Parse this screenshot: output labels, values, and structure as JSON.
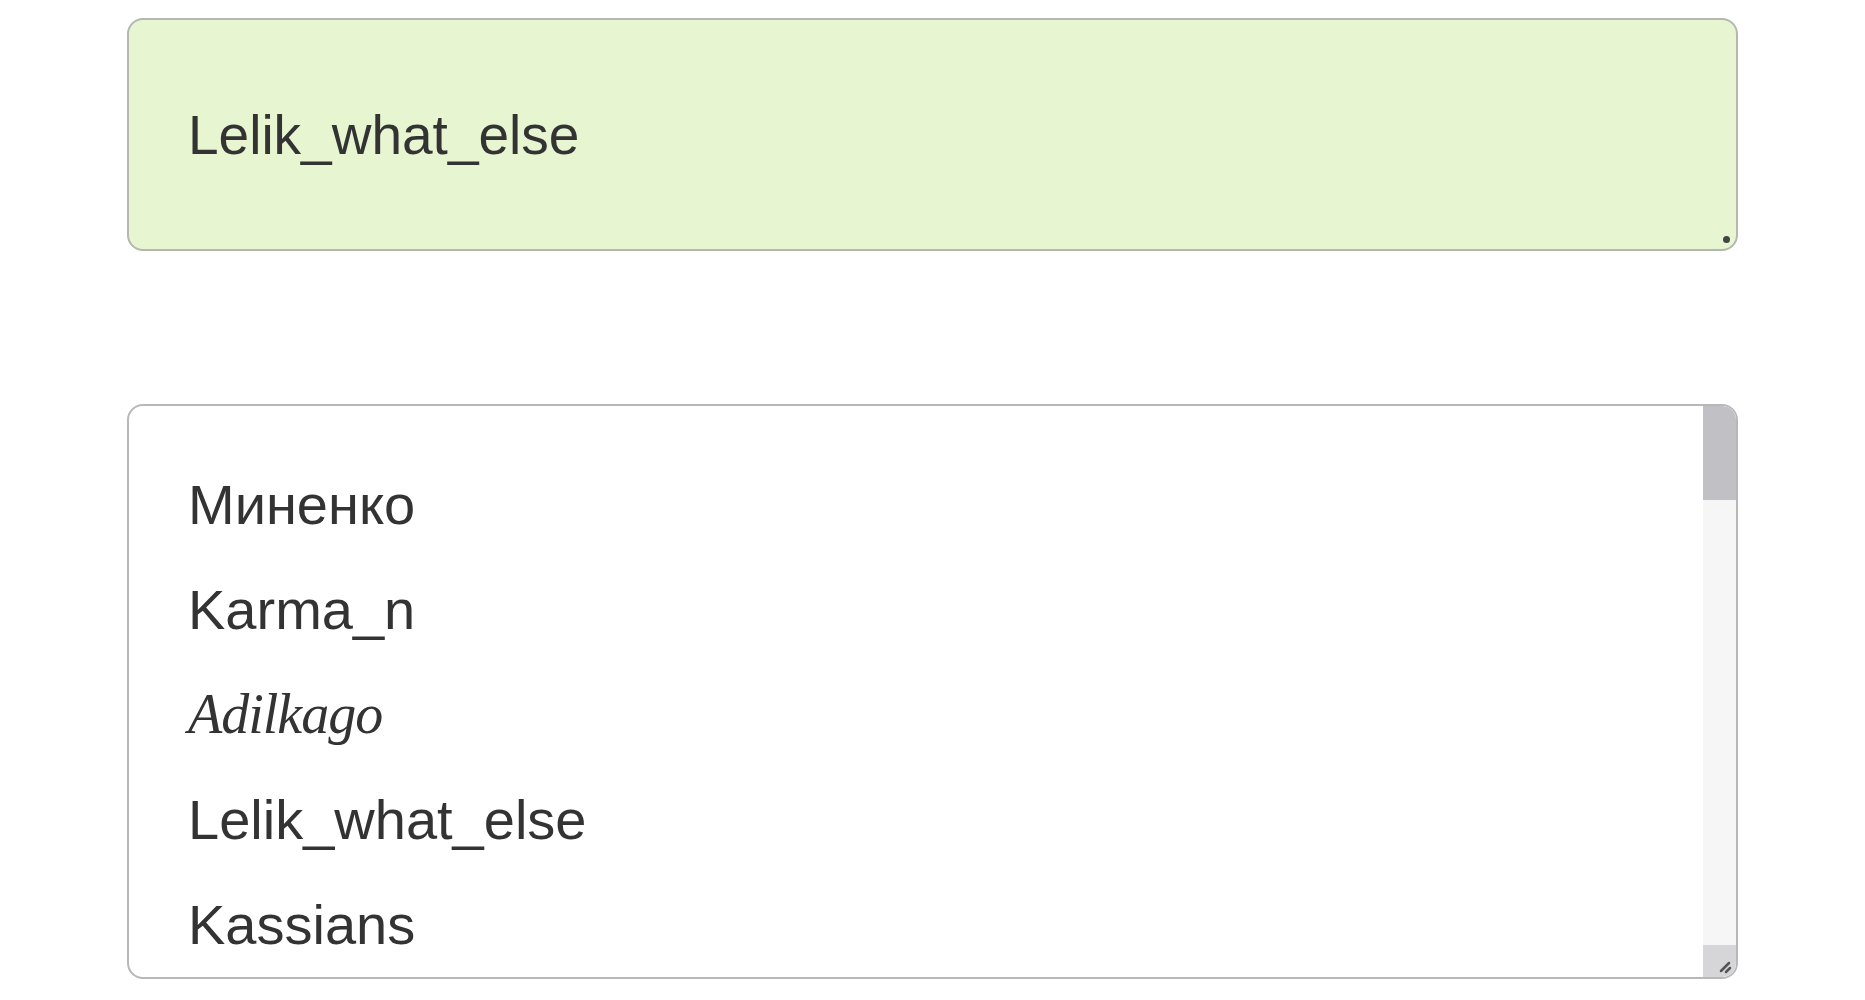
{
  "text_area": {
    "value": "Lelik_what_else"
  },
  "list_box": {
    "items": [
      {
        "label": "Миненко",
        "kind": "plain",
        "selected": false
      },
      {
        "label": "Karma_n",
        "kind": "plain",
        "selected": false
      },
      {
        "label": "Adilkago",
        "kind": "script",
        "selected": false
      },
      {
        "label": "Lelik_what_else",
        "kind": "plain",
        "selected": false
      },
      {
        "label": "Kassians",
        "kind": "plain",
        "selected": false
      }
    ]
  }
}
